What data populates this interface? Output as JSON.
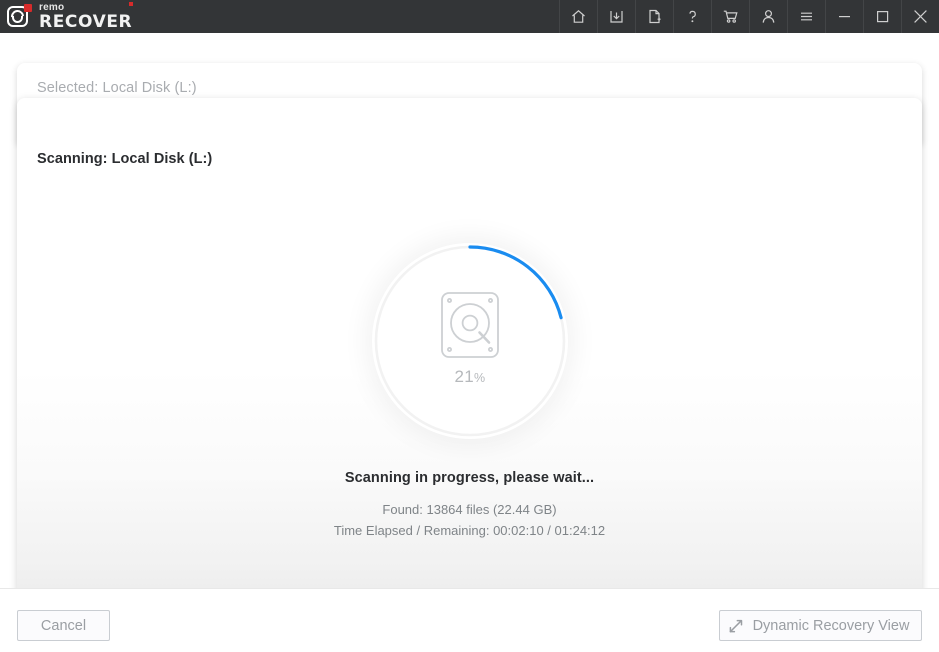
{
  "window": {
    "brand_small": "remo",
    "brand_large": "RECOVER",
    "titlebar_icons": [
      {
        "name": "home-icon",
        "label": "Home"
      },
      {
        "name": "save-icon",
        "label": "Save Recovery Session"
      },
      {
        "name": "new-file-icon",
        "label": "New Session"
      },
      {
        "name": "help-icon",
        "label": "Help"
      },
      {
        "name": "cart-icon",
        "label": "Buy"
      },
      {
        "name": "user-icon",
        "label": "Account"
      },
      {
        "name": "menu-icon",
        "label": "Menu"
      },
      {
        "name": "minimize-icon",
        "label": "Minimize"
      },
      {
        "name": "maximize-icon",
        "label": "Maximize"
      },
      {
        "name": "close-icon",
        "label": "Close"
      }
    ]
  },
  "selected_card": {
    "label": "Selected: Local Disk (L:)"
  },
  "scan_card": {
    "label": "Scanning: Local Disk (L:)"
  },
  "progress": {
    "percent": 21,
    "percent_value": "21",
    "percent_symbol": "%",
    "accent_color": "#1a8cf0",
    "track_color": "#f2f2f2",
    "icon": "hard-disk-scan-icon"
  },
  "status": {
    "headline": "Scanning in progress, please wait...",
    "found": "Found: 13864 files (22.44 GB)",
    "time": "Time Elapsed / Remaining:  00:02:10 / 01:24:12",
    "found_count": 13864,
    "found_size": "22.44 GB",
    "time_elapsed": "00:02:10",
    "time_remaining": "01:24:12"
  },
  "footer": {
    "cancel_label": "Cancel",
    "dynamic_view_label": "Dynamic Recovery View"
  }
}
